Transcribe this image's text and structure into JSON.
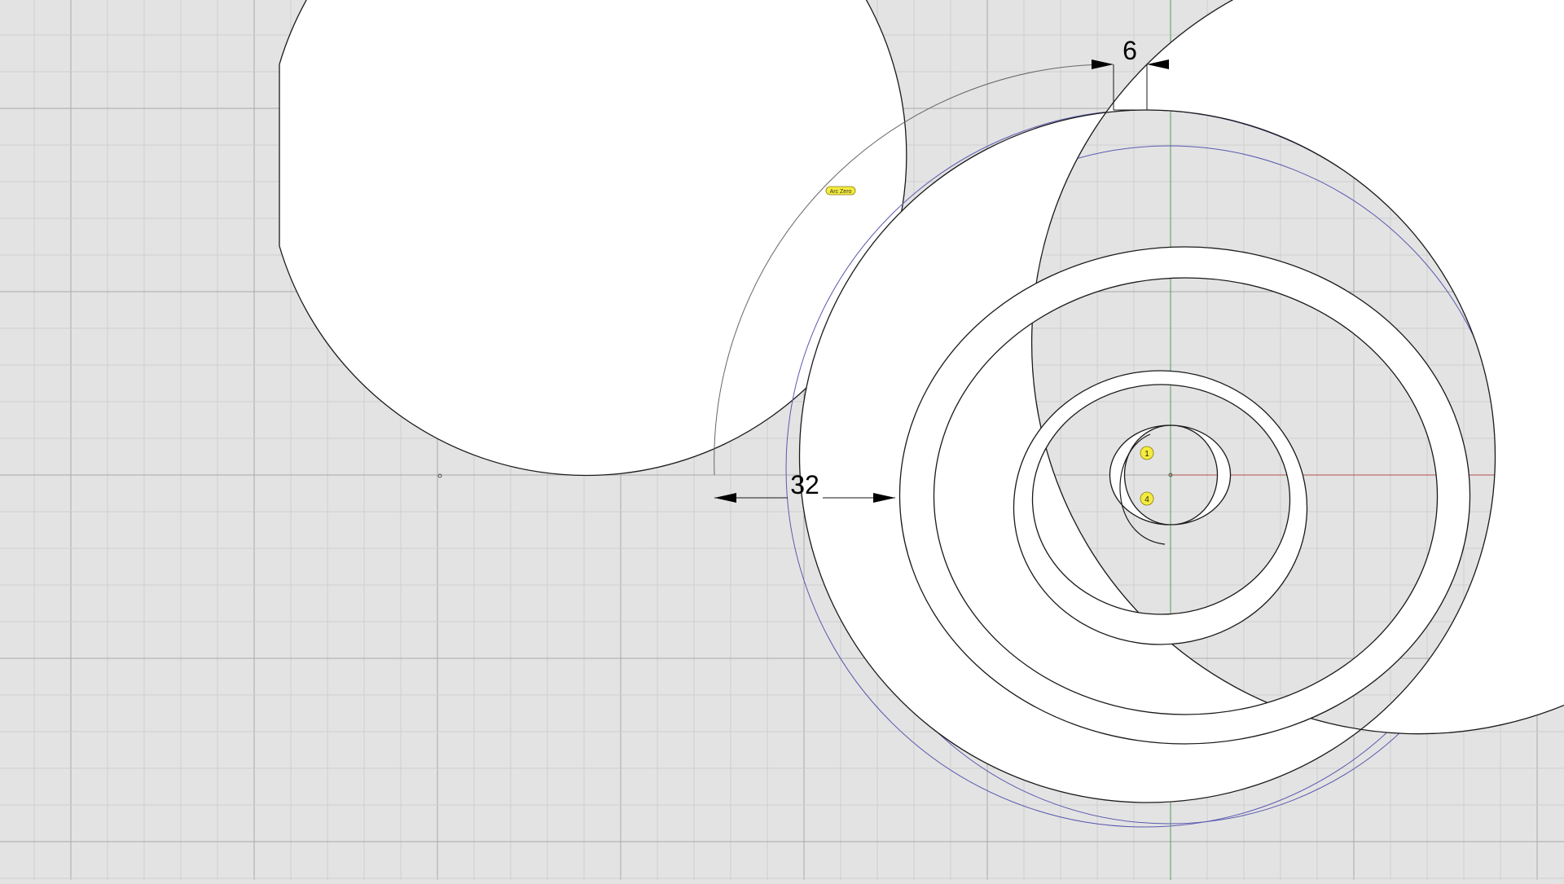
{
  "viewport": {
    "background": "#e3e3e3",
    "grid_minor_color": "#cfcfcf",
    "grid_major_color": "#a9a9a9",
    "x_axis_color": "#b05050",
    "y_axis_color": "#5a9a5a",
    "curve_color": "#1a1a1a",
    "construction_color": "#5a5ab0",
    "fill_color": "#ffffff"
  },
  "dimensions": {
    "gap_label": "6",
    "radial_label": "32"
  },
  "tags": {
    "arc_zero": "Arc Zero",
    "point_1": "1",
    "point_4": "4",
    "tag_color": "#f4ec3c"
  }
}
